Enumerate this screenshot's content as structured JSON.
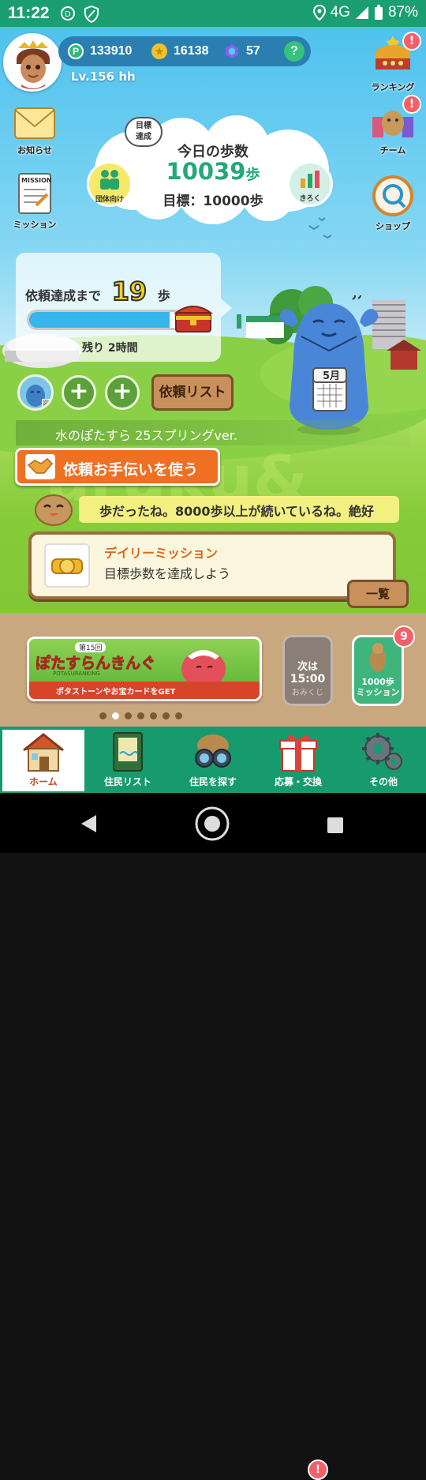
{
  "status_bar": {
    "time": "11:22",
    "network": "4G",
    "battery": "87%"
  },
  "header": {
    "points": "133910",
    "coins": "16138",
    "gems": "57",
    "help": "?",
    "level": "Lv.156 hh",
    "point_symbol": "P"
  },
  "side_left": [
    {
      "label": "お知らせ",
      "icon": "mail-icon"
    },
    {
      "label": "ミッション",
      "icon": "mission-clipboard-icon",
      "sign": "MISSION"
    }
  ],
  "side_right": [
    {
      "label": "ランキング",
      "icon": "crown-icon",
      "badge": "!"
    },
    {
      "label": "チーム",
      "icon": "team-icon",
      "badge": "!"
    },
    {
      "label": "ショップ",
      "icon": "shop-icon"
    }
  ],
  "steps": {
    "goal_tag": "目標\n達成",
    "title": "今日の歩数",
    "count": "10039",
    "unit": "歩",
    "goal": "目標：10000歩",
    "group_label": "団体向け",
    "record_label": "きろく"
  },
  "request": {
    "prefix": "依頼達成まで",
    "number": "19",
    "suffix": "歩",
    "progress": 0.92,
    "remaining": "残り 2時間",
    "list_button": "依頼リスト",
    "plus": "+",
    "slot_badge": "図"
  },
  "character": {
    "calendar_label": "5月"
  },
  "ticker_text": "水のぽたすら 25スプリングver.",
  "help_button": "依頼お手伝いを使う",
  "speech_text": "歩だったね。8000歩以上が続いているね。絶好",
  "daily_mission": {
    "title": "デイリーミッション",
    "desc": "目標歩数を達成しよう",
    "list_button": "一覧"
  },
  "banner": {
    "edition": "第15回",
    "title": "ぽたすらんきんぐ",
    "subtitle": "POTASURANKING",
    "caption": "ポタストーンやお宝カードをGET"
  },
  "omikuji": {
    "line1": "次は",
    "time": "15:00",
    "label": "おみくじ"
  },
  "step_mission": {
    "badge": "9",
    "label1": "1000歩",
    "label2": "ミッション"
  },
  "carousel": {
    "count": 7,
    "active_index": 1
  },
  "nav": [
    {
      "label": "ホーム",
      "icon": "house-icon",
      "active": true
    },
    {
      "label": "住民リスト",
      "icon": "resident-list-icon"
    },
    {
      "label": "住民を探す",
      "icon": "binoculars-icon"
    },
    {
      "label": "応募・交換",
      "icon": "gift-icon",
      "badge": "!"
    },
    {
      "label": "その他",
      "icon": "gear-icon"
    }
  ],
  "colors": {
    "status_green": "#1b9e72",
    "pill_blue": "#2a7fb0",
    "accent_orange": "#ef6f23",
    "badge_red": "#f2606a"
  }
}
